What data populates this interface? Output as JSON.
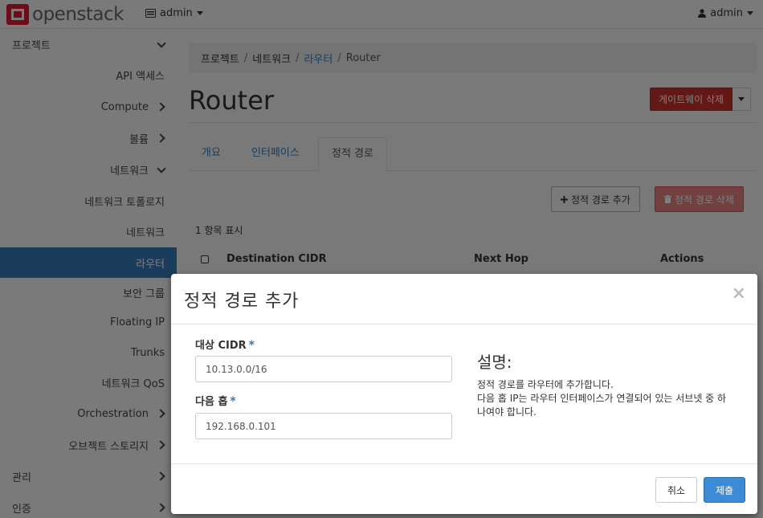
{
  "topbar": {
    "logo_prefix": "open",
    "logo_text": "stack",
    "project_icon": "server-icon",
    "project_label": "admin",
    "user_icon": "user-icon",
    "user_label": "admin"
  },
  "sidebar": {
    "items": [
      {
        "label": "프로젝트",
        "chevron": "down"
      },
      {
        "label": "API 액세스",
        "chevron": ""
      },
      {
        "label": "Compute",
        "chevron": "right"
      },
      {
        "label": "볼륨",
        "chevron": "right"
      },
      {
        "label": "네트워크",
        "chevron": "down"
      },
      {
        "label": "네트워크 토폴로지",
        "chevron": ""
      },
      {
        "label": "네트워크",
        "chevron": ""
      },
      {
        "label": "라우터",
        "chevron": "",
        "active": true
      },
      {
        "label": "보안 그룹",
        "chevron": ""
      },
      {
        "label": "Floating IP",
        "chevron": ""
      },
      {
        "label": "Trunks",
        "chevron": ""
      },
      {
        "label": "네트워크 QoS",
        "chevron": ""
      },
      {
        "label": "Orchestration",
        "chevron": "right"
      },
      {
        "label": "오브젝트 스토리지",
        "chevron": "right"
      },
      {
        "label": "관리",
        "chevron": "right"
      },
      {
        "label": "인증",
        "chevron": "right"
      }
    ]
  },
  "breadcrumb": {
    "items": [
      "프로젝트",
      "네트워크",
      "라우터",
      "Router"
    ],
    "separator": "/"
  },
  "page": {
    "title": "Router",
    "gateway_delete_label": "게이트웨이 삭제"
  },
  "tabs": {
    "items": [
      "개요",
      "인터페이스",
      "정적 경로"
    ],
    "active_index": 2
  },
  "actions": {
    "add_label": "정적 경로 추가",
    "delete_label": "정적 경로 삭제"
  },
  "table": {
    "count_text": "1 항목 표시",
    "columns": [
      "Destination CIDR",
      "Next Hop",
      "Actions"
    ]
  },
  "modal": {
    "title": "정적 경로 추가",
    "close_glyph": "×",
    "dest_label": "대상 CIDR",
    "dest_value": "10.13.0.0/16",
    "nexthop_label": "다음 홉",
    "nexthop_value": "192.168.0.101",
    "required_mark": "*",
    "desc_title": "설명:",
    "desc_line1": "정적 경로를 라우터에 추가합니다.",
    "desc_line2": "다음 홉 IP는 라우터 인터페이스가 연결되어 있는 서브넷 중 하나여야 합니다.",
    "cancel_label": "취소",
    "submit_label": "제출"
  },
  "colors": {
    "accent": "#337ab7",
    "danger": "#c9302c",
    "brand": "#da1a32"
  }
}
